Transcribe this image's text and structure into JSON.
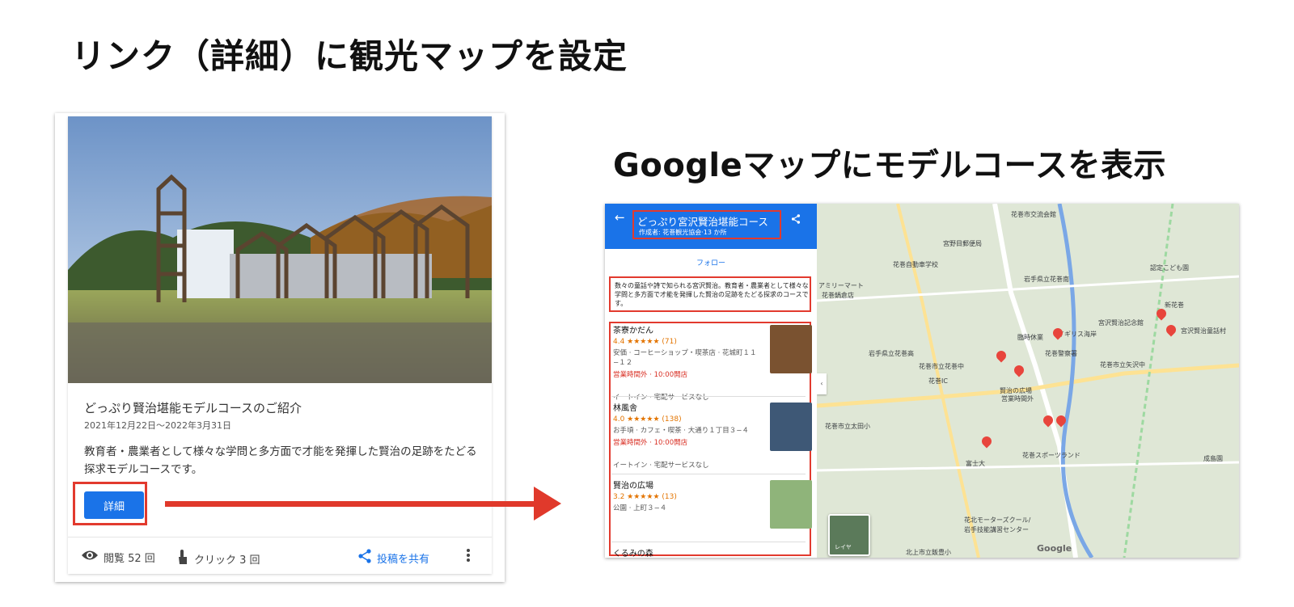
{
  "headings": {
    "left": "リンク（詳細）に観光マップを設定",
    "right": "Googleマップにモデルコースを表示"
  },
  "post": {
    "title": "どっぷり賢治堪能モデルコースのご紹介",
    "date": "2021年12月22日〜2022年3月31日",
    "description": "教育者・農業者として様々な学問と多方面で才能を発揮した賢治の足跡をたどる探求モデルコースです。",
    "button_label": "詳細",
    "views": "閲覧 52 回",
    "clicks": "クリック 3 回",
    "share": "投稿を共有"
  },
  "maps": {
    "list_title": "どっぷり宮沢賢治堪能コース",
    "list_subtitle": "作成者: 花巻観光協会·13 か所",
    "follow": "フォロー",
    "description": "数々の童話や詩で知られる宮沢賢治。教育者・農業者として様々な学問と多方面で才能を発揮した賢治の足跡をたどる探求のコースです。",
    "places": [
      {
        "name": "茶寮かだん",
        "rating": "4.4 ★★★★★ (71)",
        "meta": "安価 · コーヒーショップ・喫茶店 · 花城町１１−１２",
        "hours": "営業時間外 · 10:00開店",
        "extra": "イートイン · 宅配サービスなし"
      },
      {
        "name": "林風舎",
        "rating": "4.0 ★★★★★ (138)",
        "meta": "お手頃 · カフェ・喫茶 · 大通り１丁目３−４",
        "hours": "営業時間外 · 10:00開店",
        "extra": "イートイン · 宅配サービスなし"
      },
      {
        "name": "賢治の広場",
        "rating": "3.2 ★★★★★ (13)",
        "meta": "公園 · 上町３−４",
        "hours": "",
        "extra": ""
      },
      {
        "name": "くるみの森",
        "rating": "",
        "meta": "",
        "hours": "",
        "extra": ""
      }
    ],
    "map_labels": [
      "花巻市交流会館",
      "宮野目郵便局",
      "花巻自動車学校",
      "アミリーマート",
      "花巻鍋倉店",
      "岩手県立花巻南",
      "岩手県立花巻高",
      "花巻市立花巻中",
      "臨時休業",
      "イギリス海岸",
      "花巻警察署",
      "宮沢賢治記念館",
      "宮沢賢治童話村",
      "認定こども園",
      "花巻IC",
      "花巻市立矢沢中",
      "賢治の広場",
      "営業時間外",
      "花巻市立太田小",
      "花巻スポーツランド",
      "富士大",
      "花北モーターズクール/",
      "岩手技能講習センター",
      "北上市立飯豊小",
      "成島園",
      "レイヤ",
      "Google",
      "新花巻"
    ]
  },
  "colors": {
    "accent": "#1a73e8",
    "highlight": "#e23a2e"
  }
}
